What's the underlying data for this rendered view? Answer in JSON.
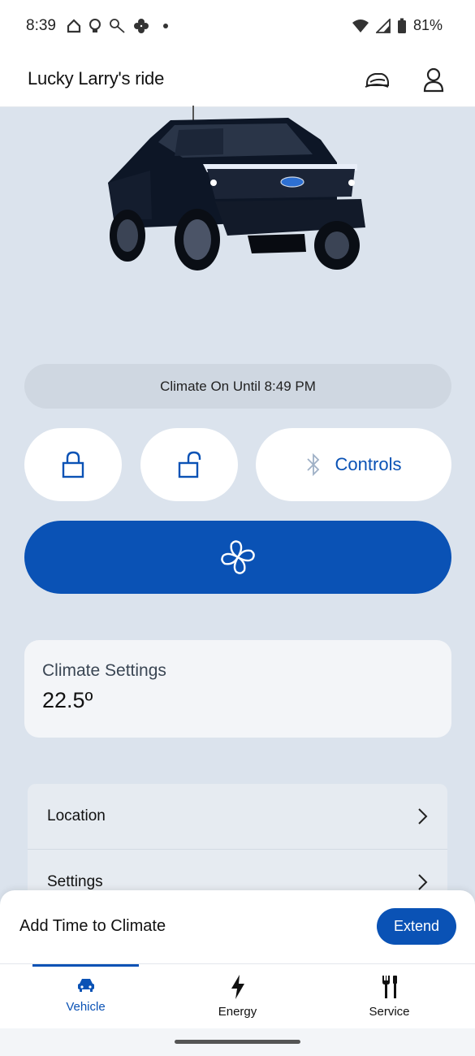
{
  "status_bar": {
    "time": "8:39",
    "battery": "81%",
    "left_icons": [
      "home-icon",
      "bulb-icon",
      "key-icon",
      "fan-notification-icon",
      "dot-icon"
    ],
    "right_icons": [
      "wifi-icon",
      "signal-icon",
      "battery-icon"
    ]
  },
  "header": {
    "title": "Lucky Larry's ride",
    "icons": [
      "vehicle-switch-icon",
      "account-icon"
    ]
  },
  "vehicle": {
    "image": "pickup-truck-image"
  },
  "climate_status": {
    "text": "Climate On Until 8:49 PM"
  },
  "controls": {
    "lock_icon": "lock-icon",
    "unlock_icon": "unlock-icon",
    "controls_label": "Controls",
    "controls_icon": "bluetooth-icon",
    "fan_icon": "fan-icon"
  },
  "climate_settings": {
    "title": "Climate Settings",
    "value": "22.5º"
  },
  "menu": {
    "items": [
      {
        "label": "Location"
      },
      {
        "label": "Settings"
      }
    ]
  },
  "sheet": {
    "label": "Add Time to Climate",
    "button": "Extend"
  },
  "tabs": [
    {
      "label": "Vehicle",
      "icon": "car-icon",
      "active": true
    },
    {
      "label": "Energy",
      "icon": "lightning-icon",
      "active": false
    },
    {
      "label": "Service",
      "icon": "tools-icon",
      "active": false
    }
  ],
  "colors": {
    "accent": "#0a52b5",
    "background": "#dbe3ed"
  }
}
